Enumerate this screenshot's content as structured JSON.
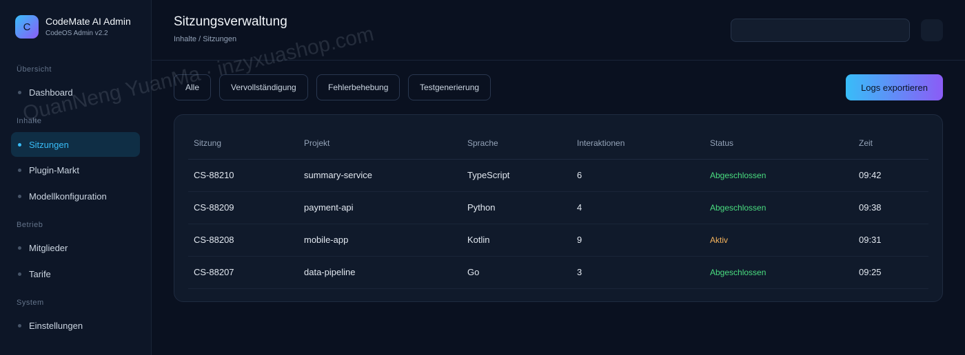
{
  "brand": {
    "logo_letter": "C",
    "title": "CodeMate AI Admin",
    "subtitle": "CodeOS Admin v2.2"
  },
  "sidebar": {
    "sections": [
      {
        "label": "Übersicht"
      },
      {
        "label": "Inhalte"
      },
      {
        "label": "Betrieb"
      },
      {
        "label": "System"
      }
    ],
    "items": [
      {
        "label": "Dashboard",
        "icon": "dot-icon"
      },
      {
        "label": "Sitzungen",
        "icon": "dot-icon",
        "active": true
      },
      {
        "label": "Plugin-Markt",
        "icon": "dot-icon"
      },
      {
        "label": "Modellkonfiguration",
        "icon": "dot-icon"
      },
      {
        "label": "Mitglieder",
        "icon": "dot-icon"
      },
      {
        "label": "Tarife",
        "icon": "dot-icon"
      },
      {
        "label": "Einstellungen",
        "icon": "dot-icon"
      }
    ]
  },
  "header": {
    "title": "Sitzungsverwaltung",
    "breadcrumb": "Inhalte / Sitzungen",
    "search": {
      "value": "",
      "placeholder": ""
    }
  },
  "filters": [
    {
      "label": "Alle"
    },
    {
      "label": "Vervollständigung"
    },
    {
      "label": "Fehlerbehebung"
    },
    {
      "label": "Testgenerierung"
    }
  ],
  "export_label": "Logs exportieren",
  "table": {
    "columns": [
      "Sitzung",
      "Projekt",
      "Sprache",
      "Interaktionen",
      "Status",
      "Zeit"
    ],
    "rows": [
      [
        "CS-88210",
        "summary-service",
        "TypeScript",
        "6",
        "Abgeschlossen",
        "09:42"
      ],
      [
        "CS-88209",
        "payment-api",
        "Python",
        "4",
        "Abgeschlossen",
        "09:38"
      ],
      [
        "CS-88208",
        "mobile-app",
        "Kotlin",
        "9",
        "Aktiv",
        "09:31"
      ],
      [
        "CS-88207",
        "data-pipeline",
        "Go",
        "3",
        "Abgeschlossen",
        "09:25"
      ]
    ]
  },
  "colors": {
    "accent": "#38bdf8",
    "accent_secondary": "#8b5cf6",
    "status_done": "#4ade80",
    "status_active": "#f5b35c",
    "background": "#0a1120"
  },
  "watermark": "QuanNeng YuanMa · inzyxuashop.com"
}
